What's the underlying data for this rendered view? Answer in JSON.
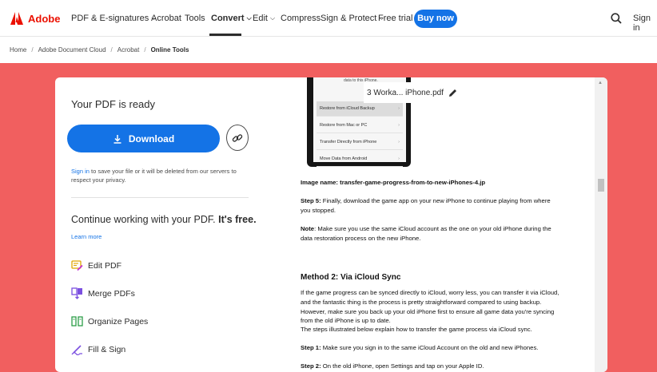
{
  "brand": {
    "name": "Adobe",
    "color": "#eb1000"
  },
  "nav": {
    "items": [
      {
        "label": "PDF & E-signatures",
        "caret": true
      },
      {
        "label": "Acrobat",
        "caret": false
      },
      {
        "label": "Tools",
        "caret": false
      },
      {
        "label": "Convert",
        "caret": true,
        "active": true
      },
      {
        "label": "Edit",
        "caret": true
      },
      {
        "label": "Compress",
        "caret": false
      },
      {
        "label": "Sign & Protect",
        "caret": true
      },
      {
        "label": "Free trial",
        "caret": false
      }
    ],
    "buy_now": "Buy now",
    "sign_in": "Sign in",
    "search_icon": "search-icon"
  },
  "breadcrumb": [
    "Home",
    "Adobe Document Cloud",
    "Acrobat",
    "Online Tools"
  ],
  "colors": {
    "band": "#f15f5f",
    "primary": "#1473e6"
  },
  "panel": {
    "ready_title": "Your PDF is ready",
    "download_label": "Download",
    "sign_in_link": "Sign in",
    "save_note": " to save your file or it will be deleted from our servers to respect your privacy.",
    "continue_text": "Continue working with your PDF. ",
    "continue_bold": "It's free.",
    "learn_more": "Learn more",
    "tools": [
      {
        "label": "Edit PDF",
        "icon": "edit-pdf-icon"
      },
      {
        "label": "Merge PDFs",
        "icon": "merge-pdfs-icon"
      },
      {
        "label": "Organize Pages",
        "icon": "organize-pages-icon"
      },
      {
        "label": "Fill & Sign",
        "icon": "fill-sign-icon"
      }
    ]
  },
  "preview": {
    "filename": "3 Worka... iPhone.pdf",
    "phone": {
      "header": "data to this iPhone.",
      "options": [
        "Restore from iCloud Backup",
        "Restore from Mac or PC",
        "Transfer Directly from iPhone",
        "Move Data from Android"
      ]
    },
    "doc": {
      "image_name_label": "Image name: ",
      "image_name_value": "transfer-game-progress-from-to-new-iPhones-4.jp",
      "step5_label": "Step 5:",
      "step5_line1": " Finally, download the game app on your new iPhone to continue playing from where",
      "step5_line2": "you stopped.",
      "note_label": "Note",
      "note_line1": ": Make sure you use the same iCloud account as the one on your old iPhone during the",
      "note_line2": "data restoration process on the new iPhone.",
      "method2_heading": "Method 2: Via iCloud Sync",
      "m2_line1": "If the game progress can be synced directly to iCloud, worry less, you can transfer it via iCloud,",
      "m2_line2": "and the fantastic thing is the process is pretty straightforward compared to using backup.",
      "m2_line3": "However, make sure you back up your old iPhone first to ensure all game data you're syncing",
      "m2_line4": "from the old iPhone is up to date.",
      "m2_line5": "The steps illustrated below explain how to transfer the game process via iCloud sync.",
      "step1_label": "Step 1:",
      "step1_text": " Make sure you sign in to the same iCloud Account on the old and new iPhones.",
      "step2_label": "Step 2:",
      "step2_text": " On the old iPhone, open Settings and tap on your Apple ID."
    }
  }
}
